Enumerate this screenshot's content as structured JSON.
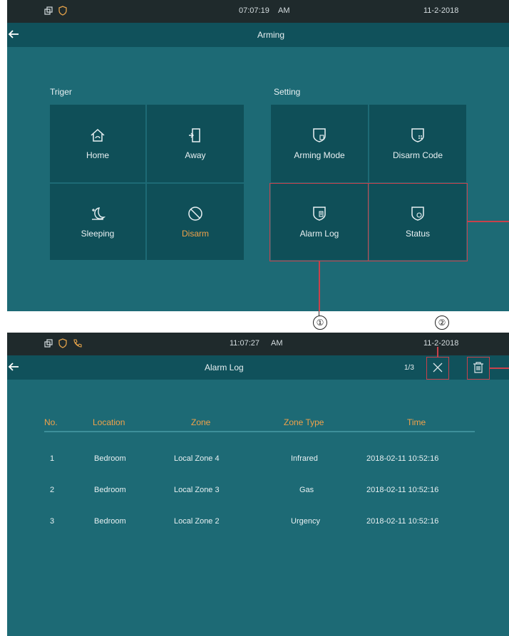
{
  "colors": {
    "accent": "#f0a24a",
    "background": "#1d6a75",
    "tile": "#0f4f58",
    "highlight": "#c9414b"
  },
  "screen1": {
    "status": {
      "time": "07:07:19",
      "ampm": "AM",
      "date": "11-2-2018",
      "icons": [
        "window-icon",
        "shield-icon"
      ]
    },
    "title": "Arming",
    "trigger_label": "Triger",
    "setting_label": "Setting",
    "trigger_tiles": [
      {
        "label": "Home",
        "icon": "home-icon"
      },
      {
        "label": "Away",
        "icon": "door-icon"
      },
      {
        "label": "Sleeping",
        "icon": "moon-icon"
      },
      {
        "label": "Disarm",
        "icon": "disarm-icon",
        "active": true
      }
    ],
    "setting_tiles": [
      {
        "label": "Arming Mode",
        "icon": "arming-mode-icon"
      },
      {
        "label": "Disarm Code",
        "icon": "disarm-code-icon"
      },
      {
        "label": "Alarm Log",
        "icon": "alarm-log-icon"
      },
      {
        "label": "Status",
        "icon": "status-icon"
      }
    ]
  },
  "callouts": [
    "①",
    "②"
  ],
  "screen2": {
    "status": {
      "time": "11:07:27",
      "ampm": "AM",
      "date": "11-2-2018",
      "icons": [
        "window-icon",
        "shield-icon",
        "phone-icon"
      ]
    },
    "title": "Alarm Log",
    "page": "1/3",
    "columns": [
      "No.",
      "Location",
      "Zone",
      "Zone Type",
      "Time"
    ],
    "rows": [
      [
        "1",
        "Bedroom",
        "Local Zone 4",
        "Infrared",
        "2018-02-11 10:52:16"
      ],
      [
        "2",
        "Bedroom",
        "Local Zone 3",
        "Gas",
        "2018-02-11 10:52:16"
      ],
      [
        "3",
        "Bedroom",
        "Local Zone 2",
        "Urgency",
        "2018-02-11 10:52:16"
      ]
    ]
  }
}
